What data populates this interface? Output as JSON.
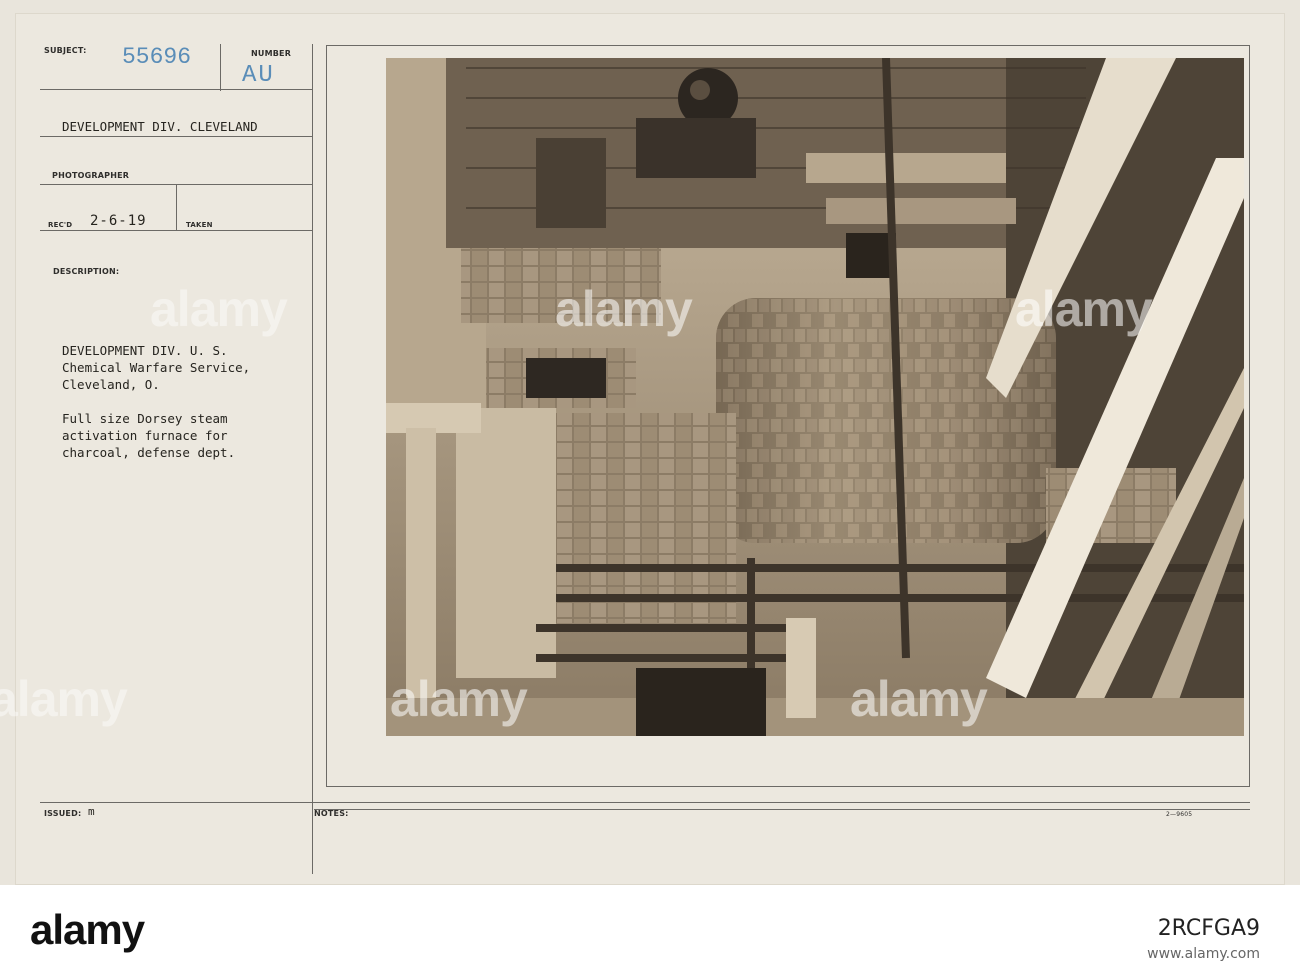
{
  "card": {
    "subject_label": "SUBJECT:",
    "subject_number": "55696",
    "number_label": "NUMBER",
    "number_value": "AU",
    "division": "DEVELOPMENT DIV. CLEVELAND",
    "photographer_label": "PHOTOGRAPHER",
    "recd_label": "REC'D",
    "recd_date": "2-6-19",
    "taken_label": "TAKEN",
    "description_label": "DESCRIPTION:",
    "description_lines": [
      "DEVELOPMENT DIV. U. S.",
      "Chemical Warfare Service,",
      "Cleveland, O.",
      "",
      "Full size Dorsey steam",
      "activation furnace for",
      "charcoal, defense dept."
    ],
    "issued_label": "ISSUED:",
    "issued_value": "m",
    "notes_label": "NOTES:",
    "form_number": "2—9605"
  },
  "watermark": "alamy",
  "bottom_bar": {
    "logo": "alamy",
    "image_id": "2RCFGA9",
    "url": "www.alamy.com"
  }
}
